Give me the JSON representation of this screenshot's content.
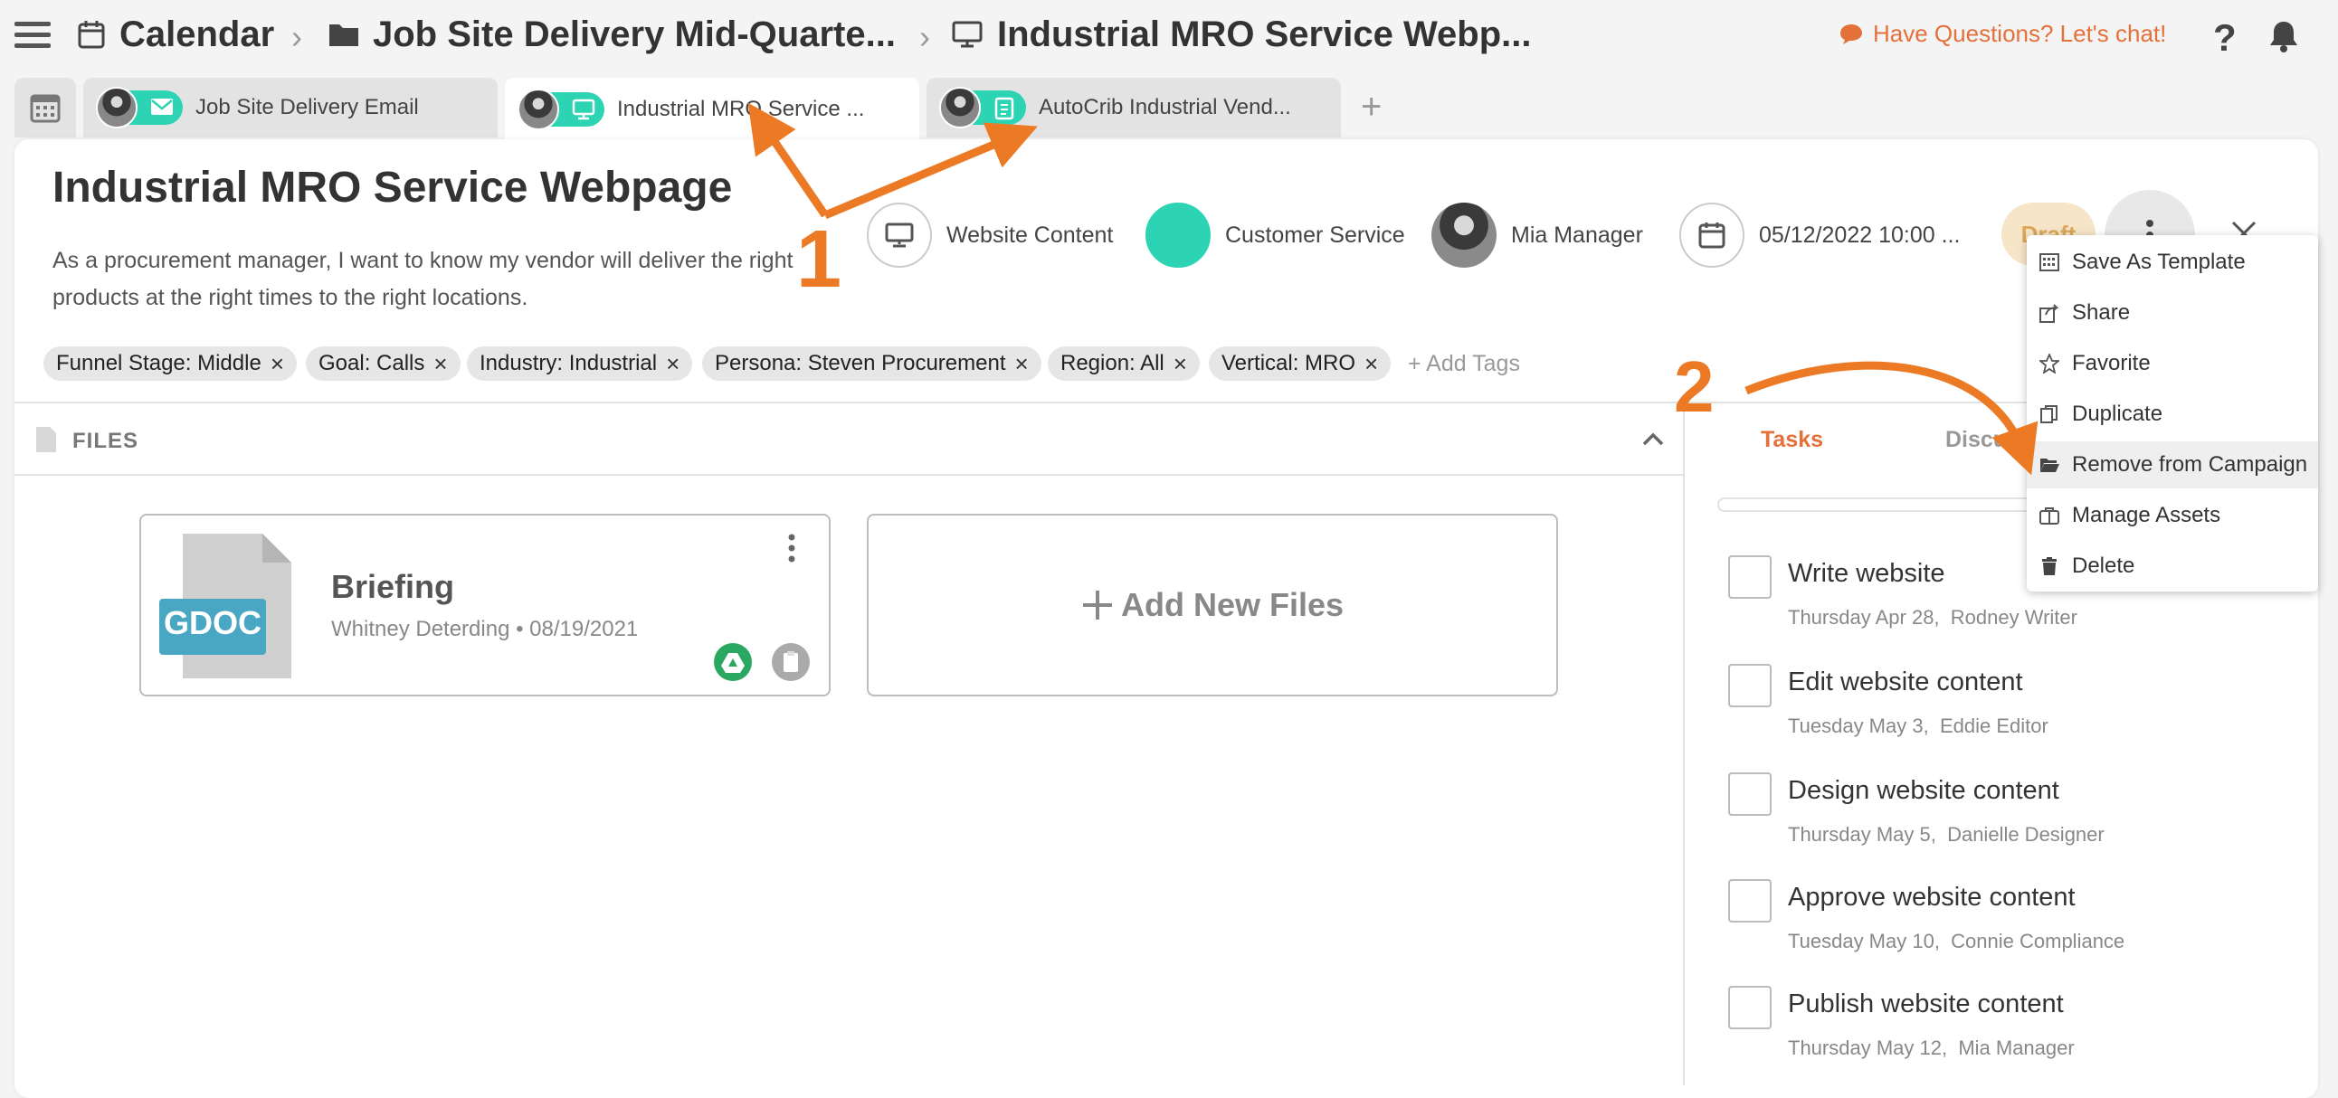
{
  "colors": {
    "accent": "#e4703a",
    "teal": "#2dd4b3",
    "annotation": "#ec7a24"
  },
  "breadcrumb": {
    "items": [
      {
        "icon": "calendar-icon",
        "label": "Calendar"
      },
      {
        "icon": "folder-icon",
        "label": "Job Site Delivery Mid-Quarte..."
      },
      {
        "icon": "monitor-icon",
        "label": "Industrial MRO Service Webp..."
      }
    ]
  },
  "header": {
    "chat_label": "Have Questions? Let's chat!"
  },
  "tabs": [
    {
      "label": "Job Site Delivery Email",
      "icon": "mail-icon"
    },
    {
      "label": "Industrial MRO Service ...",
      "icon": "monitor-icon"
    },
    {
      "label": "AutoCrib Industrial Vend...",
      "icon": "document-icon"
    }
  ],
  "detail": {
    "title": "Industrial MRO Service Webpage",
    "description": "As a procurement manager, I want to know my vendor will deliver the right products at the right times to the right locations.",
    "content_type": "Website Content",
    "category": "Customer Service",
    "owner": "Mia Manager",
    "date": "05/12/2022 10:00 ...",
    "status": "Draft"
  },
  "tags": [
    "Funnel Stage: Middle",
    "Goal: Calls",
    "Industry: Industrial",
    "Persona: Steven Procurement",
    "Region: All",
    "Vertical: MRO"
  ],
  "add_tags_label": "+ Add Tags",
  "files": {
    "header": "FILES",
    "file": {
      "badge": "GDOC",
      "name": "Briefing",
      "meta": "Whitney Deterding • 08/19/2021"
    },
    "add_label": "Add New Files"
  },
  "side_tabs": [
    "Tasks",
    "Discussion"
  ],
  "tasks": [
    {
      "title": "Write website content",
      "date": "Thursday Apr 28,",
      "assignee": "Rodney Writer"
    },
    {
      "title": "Edit website content",
      "date": "Tuesday May 3,",
      "assignee": "Eddie Editor"
    },
    {
      "title": "Design website content",
      "date": "Thursday May 5,",
      "assignee": "Danielle Designer"
    },
    {
      "title": "Approve website content",
      "date": "Tuesday May 10,",
      "assignee": "Connie Compliance"
    },
    {
      "title": "Publish website content",
      "date": "Thursday May 12,",
      "assignee": "Mia Manager"
    }
  ],
  "menu": {
    "items": [
      {
        "label": "Save As Template",
        "icon": "template-icon"
      },
      {
        "label": "Share",
        "icon": "share-icon"
      },
      {
        "label": "Favorite",
        "icon": "star-icon"
      },
      {
        "label": "Duplicate",
        "icon": "copy-icon"
      },
      {
        "label": "Remove from Campaign",
        "icon": "folder-open-icon"
      },
      {
        "label": "Manage Assets",
        "icon": "briefcase-icon"
      },
      {
        "label": "Delete",
        "icon": "trash-icon"
      }
    ],
    "highlighted": "Remove from Campaign"
  },
  "annotations": {
    "step1": "1",
    "step2": "2"
  }
}
